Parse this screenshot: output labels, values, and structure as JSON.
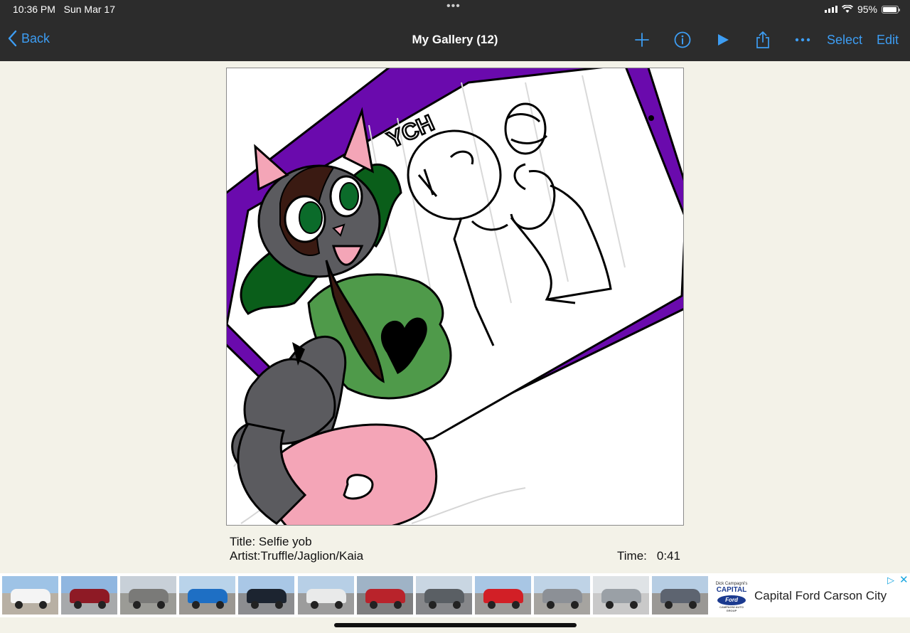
{
  "status": {
    "time": "10:36 PM",
    "date": "Sun Mar 17",
    "battery": "95%",
    "battery_level": 0.95
  },
  "nav": {
    "back_label": "Back",
    "title": "My Gallery (12)",
    "add_icon": "plus-icon",
    "info_icon": "info-icon",
    "play_icon": "play-icon",
    "share_icon": "share-icon",
    "more_icon": "ellipsis-icon",
    "select_label": "Select",
    "edit_label": "Edit",
    "accent": "#3d9df3"
  },
  "artwork": {
    "sign_text": "YCH"
  },
  "info": {
    "title_line": "Title: Selfie yob",
    "artist_line": "Artist:Truffle/Jaglion/Kaia",
    "time_label": "Time:",
    "time_value": "0:41"
  },
  "ad": {
    "thumbnails": [
      {
        "car": "#f4f4f4",
        "sky": "#9ec3e6",
        "ground": "#b8b0a4"
      },
      {
        "car": "#8e1a25",
        "sky": "#8fb6e0",
        "ground": "#a7a9ab"
      },
      {
        "car": "#7a7a78",
        "sky": "#c8d0d8",
        "ground": "#9b9b96"
      },
      {
        "car": "#1e6fc4",
        "sky": "#b9d3ea",
        "ground": "#9a9792"
      },
      {
        "car": "#1c2430",
        "sky": "#a9c7e6",
        "ground": "#8c8d90"
      },
      {
        "car": "#e9eaea",
        "sky": "#b7cfe6",
        "ground": "#9c9c9c"
      },
      {
        "car": "#b9232b",
        "sky": "#9fb3c6",
        "ground": "#7f7f80"
      },
      {
        "car": "#5a5f64",
        "sky": "#c9d6e2",
        "ground": "#86878a"
      },
      {
        "car": "#d21f26",
        "sky": "#a8c6e4",
        "ground": "#9c9a98"
      },
      {
        "car": "#8c9096",
        "sky": "#bfd3e6",
        "ground": "#a6a4a0"
      },
      {
        "car": "#9aa0a6",
        "sky": "#dfe3e6",
        "ground": "#c9c9c9"
      },
      {
        "car": "#5d6470",
        "sky": "#b6cde3",
        "ground": "#9a9895"
      }
    ],
    "logo_top": "Dick Campagni's",
    "logo_main": "CAPITAL",
    "logo_oval": "Ford",
    "logo_sub": "CAMPAGNI AUTO GROUP",
    "text": "Capital Ford Carson City"
  }
}
